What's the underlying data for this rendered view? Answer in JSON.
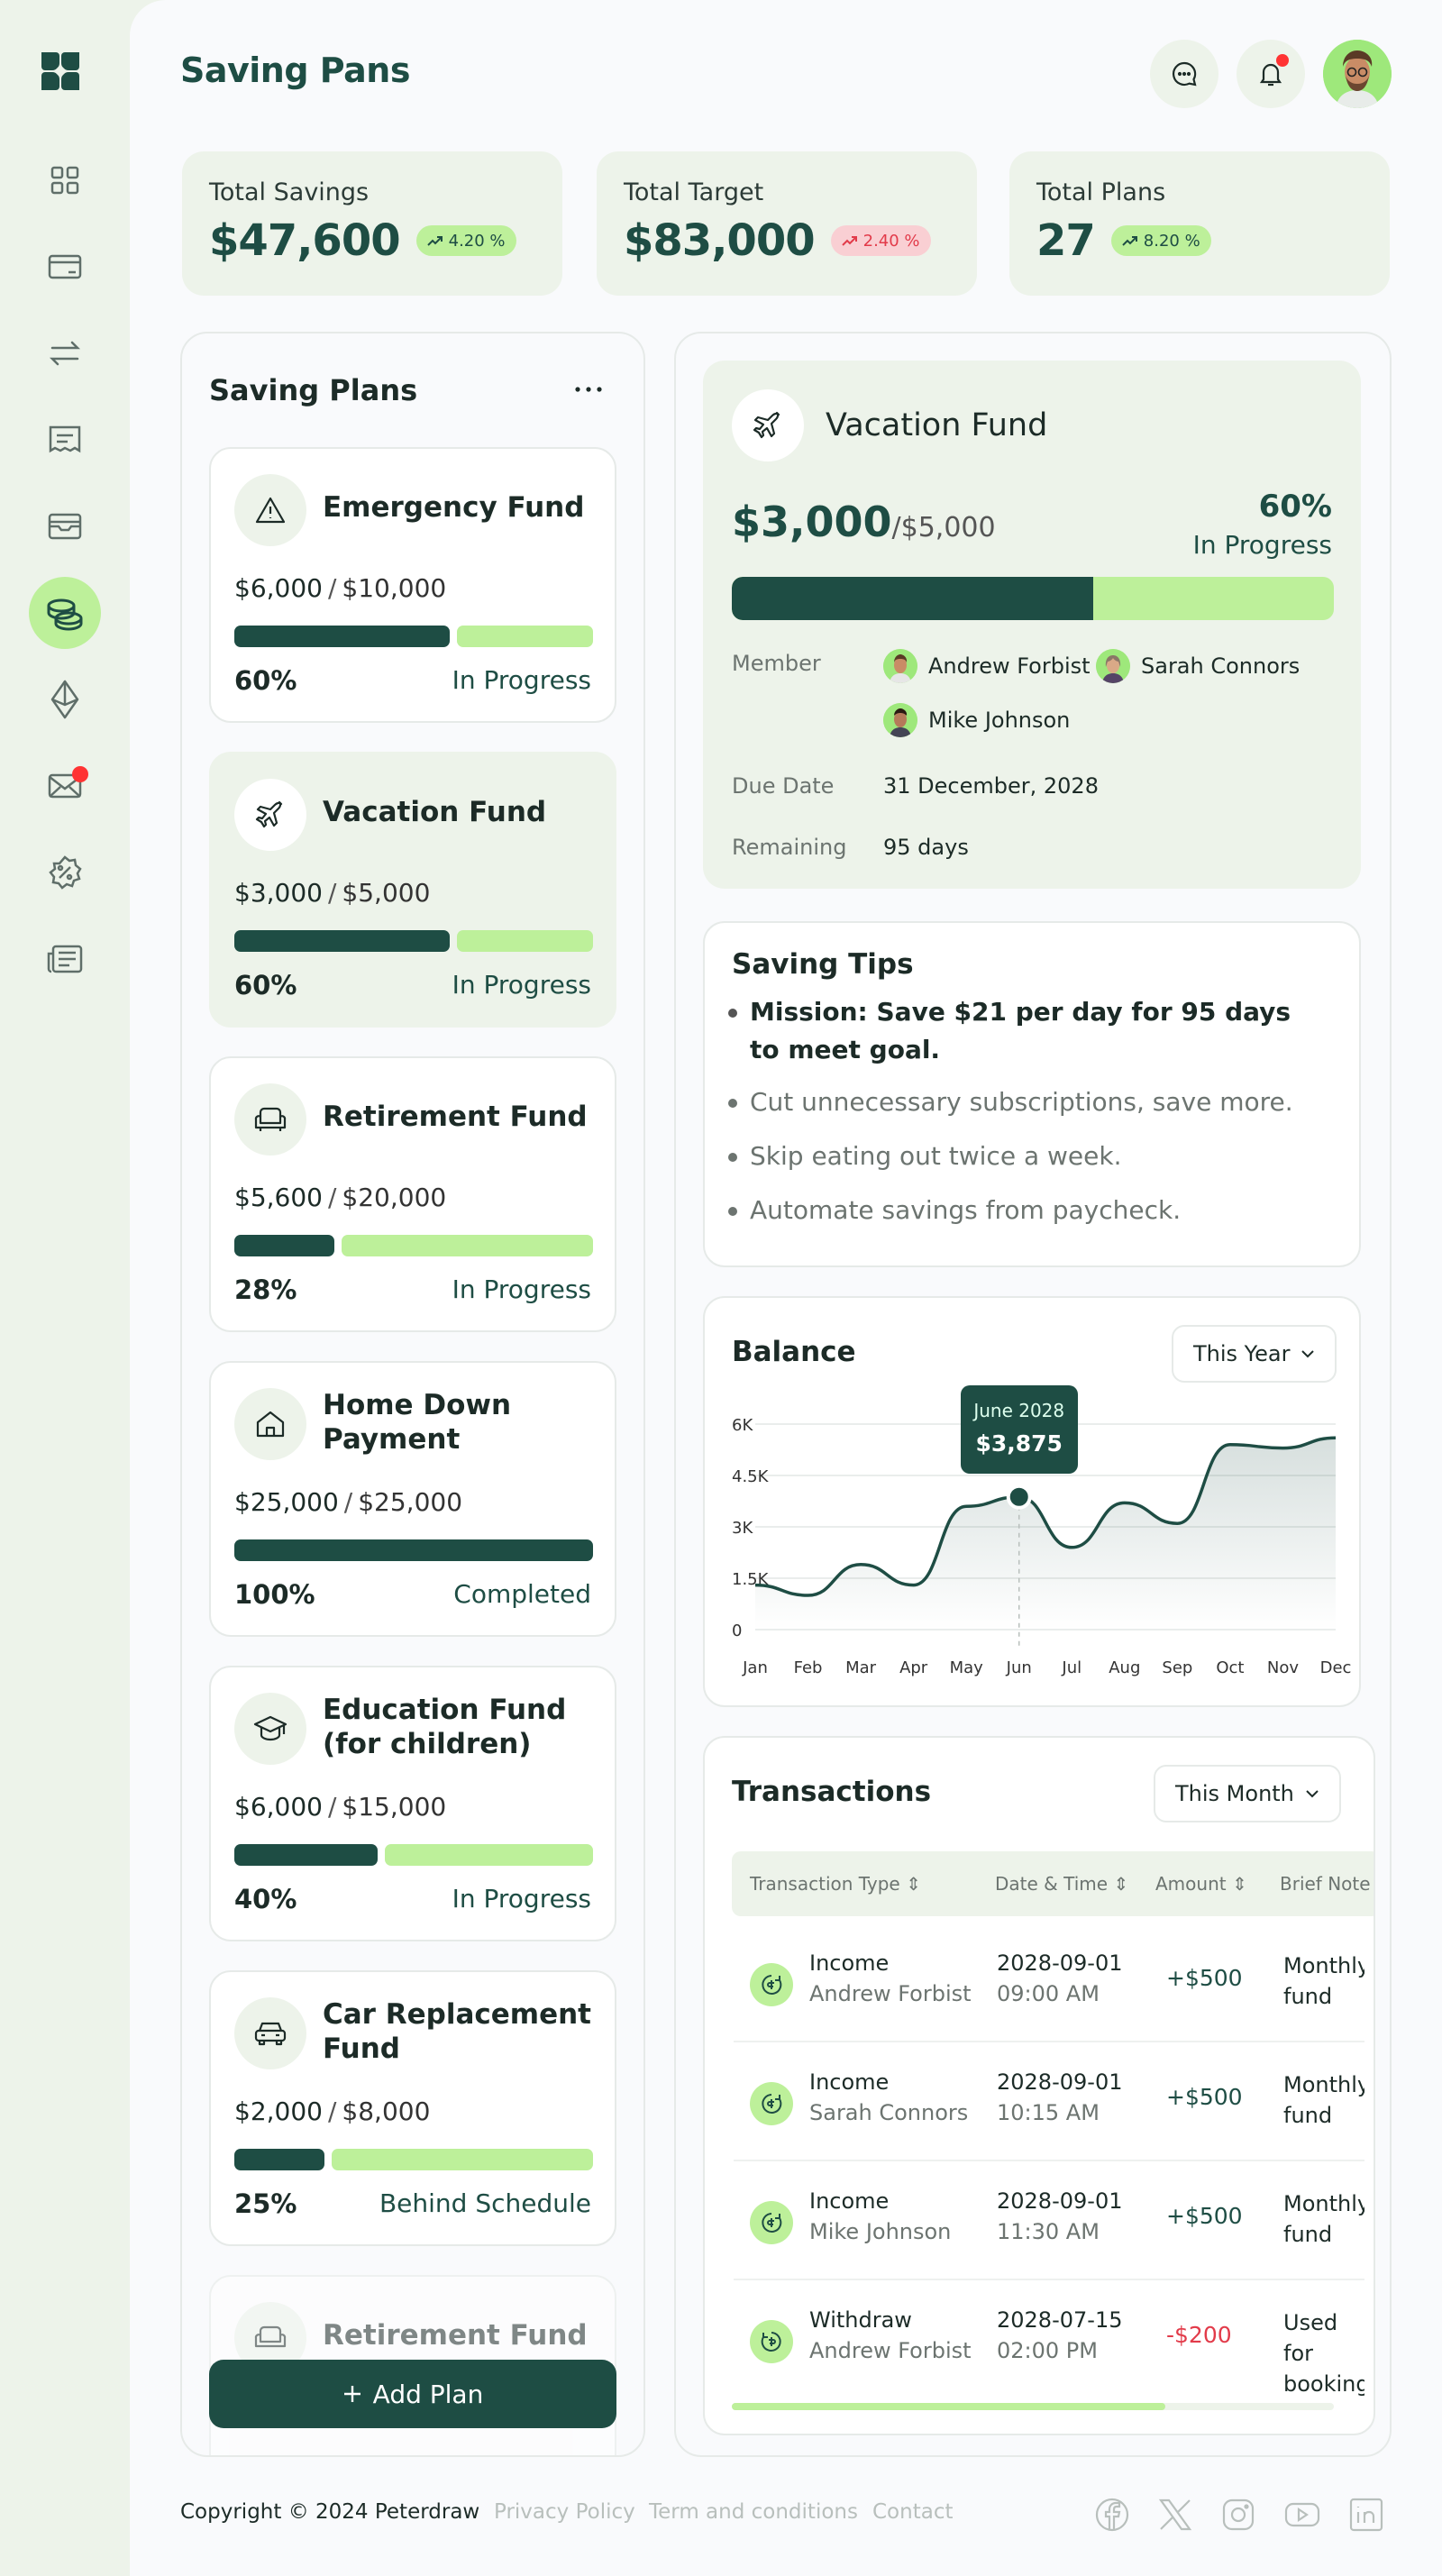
{
  "header": {
    "title": "Saving Pans"
  },
  "stats": [
    {
      "label": "Total Savings",
      "value": "$47,600",
      "change": "4.20 %",
      "trend": "up"
    },
    {
      "label": "Total Target",
      "value": "$83,000",
      "change": "2.40 %",
      "trend": "down"
    },
    {
      "label": "Total Plans",
      "value": "27",
      "change": "8.20 %",
      "trend": "up"
    }
  ],
  "sidebar": {
    "items": [
      {
        "icon": "dashboard-icon",
        "active": false
      },
      {
        "icon": "card-icon",
        "active": false
      },
      {
        "icon": "transfer-icon",
        "active": false
      },
      {
        "icon": "receipt-icon",
        "active": false
      },
      {
        "icon": "wallet-icon",
        "active": false
      },
      {
        "icon": "coins-icon",
        "active": true
      },
      {
        "icon": "crypto-icon",
        "active": false
      },
      {
        "icon": "mail-icon",
        "active": false,
        "badge": true
      },
      {
        "icon": "discount-icon",
        "active": false
      },
      {
        "icon": "news-icon",
        "active": false
      }
    ]
  },
  "plans": {
    "title": "Saving Plans",
    "menu_icon": "more-icon",
    "add_label": "Add Plan",
    "items": [
      {
        "name": "Emergency Fund",
        "icon": "warning-icon",
        "saved": "$6,000",
        "target": "$10,000",
        "progress": 0.6,
        "pct": "60%",
        "status": "In Progress"
      },
      {
        "name": "Vacation Fund",
        "icon": "plane-icon",
        "saved": "$3,000",
        "target": "$5,000",
        "progress": 0.6,
        "pct": "60%",
        "status": "In Progress",
        "selected": true
      },
      {
        "name": "Retirement Fund",
        "icon": "armchair-icon",
        "saved": "$5,600",
        "target": "$20,000",
        "progress": 0.28,
        "pct": "28%",
        "status": "In Progress"
      },
      {
        "name": "Home Down Payment",
        "icon": "home-icon",
        "saved": "$25,000",
        "target": "$25,000",
        "progress": 1.0,
        "pct": "100%",
        "status": "Completed"
      },
      {
        "name": "Education Fund (for children)",
        "icon": "graduation-icon",
        "saved": "$6,000",
        "target": "$15,000",
        "progress": 0.4,
        "pct": "40%",
        "status": "In Progress"
      },
      {
        "name": "Car Replacement Fund",
        "icon": "car-icon",
        "saved": "$2,000",
        "target": "$8,000",
        "progress": 0.25,
        "pct": "25%",
        "status": "Behind Schedule"
      },
      {
        "name": "Retirement Fund",
        "icon": "armchair-icon"
      }
    ]
  },
  "detail": {
    "name": "Vacation Fund",
    "saved": "$3,000",
    "target": "/$5,000",
    "pct": "60%",
    "status": "In Progress",
    "progress": 0.6,
    "member_label": "Member",
    "members": [
      "Andrew Forbist",
      "Sarah Connors",
      "Mike Johnson"
    ],
    "due_label": "Due Date",
    "due_value": "31 December, 2028",
    "remaining_label": "Remaining",
    "remaining_value": "95 days"
  },
  "tips": {
    "title": "Saving Tips",
    "items": [
      "Mission: Save $21 per day for 95 days to meet goal.",
      "Cut unnecessary subscriptions, save more.",
      "Skip eating out twice a week.",
      "Automate savings from paycheck."
    ]
  },
  "balance": {
    "title": "Balance",
    "filter": "This Year",
    "tooltip_month": "June 2028",
    "tooltip_value": "$3,875"
  },
  "chart_data": {
    "type": "area",
    "title": "Balance",
    "categories": [
      "Jan",
      "Feb",
      "Mar",
      "Apr",
      "May",
      "Jun",
      "Jul",
      "Aug",
      "Sep",
      "Oct",
      "Nov",
      "Dec"
    ],
    "y_ticks": [
      "6K",
      "4.5K",
      "3K",
      "1.5K",
      "0"
    ],
    "ylim": [
      0,
      6000
    ],
    "series": [
      {
        "values": [
          1300,
          1000,
          1900,
          1300,
          3600,
          3875,
          2400,
          3700,
          3100,
          5400,
          5300,
          5600
        ]
      }
    ],
    "grid": true,
    "highlight": {
      "category": "Jun",
      "value": 3875,
      "label": "June 2028"
    }
  },
  "transactions": {
    "title": "Transactions",
    "filter": "This Month",
    "columns": [
      "Transaction Type",
      "Date & Time",
      "Amount",
      "Brief Note"
    ],
    "rows": [
      {
        "type": "Income",
        "person": "Andrew Forbist",
        "date": "2028-09-01",
        "time": "09:00 AM",
        "amount": "+$500",
        "note1": "Monthly",
        "note2": "fund",
        "negative": false
      },
      {
        "type": "Income",
        "person": "Sarah Connors",
        "date": "2028-09-01",
        "time": "10:15 AM",
        "amount": "+$500",
        "note1": "Monthly",
        "note2": "fund",
        "negative": false
      },
      {
        "type": "Income",
        "person": "Mike Johnson",
        "date": "2028-09-01",
        "time": "11:30 AM",
        "amount": "+$500",
        "note1": "Monthly",
        "note2": "fund",
        "negative": false
      },
      {
        "type": "Withdraw",
        "person": "Andrew Forbist",
        "date": "2028-07-15",
        "time": "02:00 PM",
        "amount": "-$200",
        "note1": "Used for",
        "note2": "booking",
        "negative": true
      }
    ],
    "scroll_fraction": 0.72
  },
  "footer": {
    "copyright": "Copyright © 2024 Peterdraw",
    "links": [
      "Privacy Policy",
      "Term and conditions",
      "Contact"
    ],
    "social": [
      "facebook-icon",
      "x-icon",
      "instagram-icon",
      "youtube-icon",
      "linkedin-icon"
    ]
  },
  "colors": {
    "primary": "#1e4d44",
    "accent": "#bdf09a",
    "panel": "#edf3ea",
    "negative": "#e23b4a"
  }
}
